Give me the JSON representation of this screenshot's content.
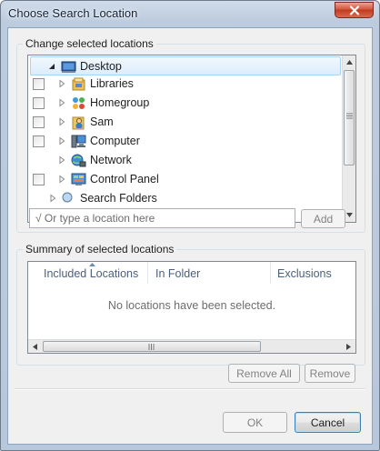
{
  "window": {
    "title": "Choose Search Location"
  },
  "change_group": {
    "label": "Change selected locations",
    "tree_items": [
      {
        "label": "Desktop",
        "icon": "desktop-icon",
        "checkbox": false,
        "expanded": true,
        "selected": true
      },
      {
        "label": "Libraries",
        "icon": "libraries-icon",
        "checkbox": true,
        "expanded": false
      },
      {
        "label": "Homegroup",
        "icon": "homegroup-icon",
        "checkbox": true,
        "expanded": false
      },
      {
        "label": "Sam",
        "icon": "user-folder-icon",
        "checkbox": true,
        "expanded": false
      },
      {
        "label": "Computer",
        "icon": "computer-icon",
        "checkbox": true,
        "expanded": false
      },
      {
        "label": "Network",
        "icon": "network-icon",
        "checkbox": false,
        "expanded": false
      },
      {
        "label": "Control Panel",
        "icon": "control-panel-icon",
        "checkbox": true,
        "expanded": false
      },
      {
        "label": "Search Folders",
        "icon": "search-folders-icon",
        "checkbox": false,
        "expanded": false
      }
    ],
    "location_placeholder": "Or type a location here",
    "add_label": "Add"
  },
  "summary_group": {
    "label": "Summary of selected locations",
    "columns": [
      "Included Locations",
      "In Folder",
      "Exclusions"
    ],
    "empty_message": "No locations have been selected.",
    "remove_all_label": "Remove All",
    "remove_label": "Remove"
  },
  "footer": {
    "ok_label": "OK",
    "cancel_label": "Cancel"
  },
  "colors": {
    "selection": "#dbecfb",
    "close_button": "#c23a1f",
    "title_bar": "#bccbdd"
  }
}
